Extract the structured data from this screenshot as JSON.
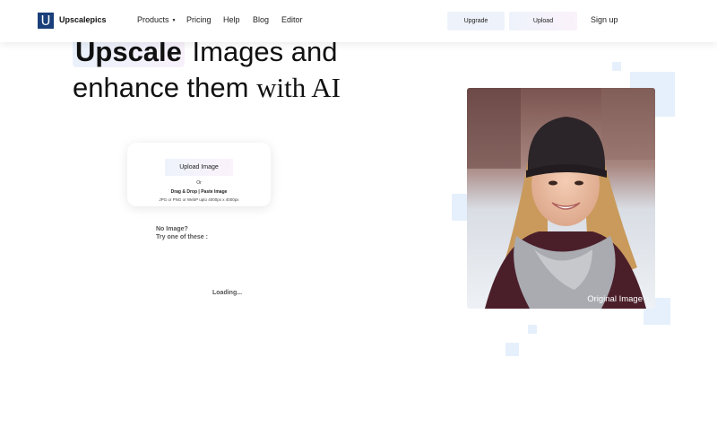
{
  "nav": {
    "logo_letter": "U",
    "brand": "Upscalepics",
    "links": [
      "Products",
      "Pricing",
      "Help",
      "Blog",
      "Editor"
    ],
    "caret": "▼",
    "upgrade_label": "Upgrade",
    "upload_label": "Upload",
    "signup_label": "Sign up"
  },
  "hero": {
    "highlight": "Upscale",
    "line1_rest": " Images and",
    "line2_a": "enhance them ",
    "line2_b": "with AI"
  },
  "upload_card": {
    "button_label": "Upload Image",
    "or_text": "Or",
    "drag_text": "Drag & Drop | Paste Image",
    "hint_text": "JPG or PNG or WebP upto 4000px x 4000px"
  },
  "samples": {
    "line1": "No Image?",
    "line2": "Try one of these :",
    "loading": "Loading..."
  },
  "preview": {
    "label": "Original Image"
  },
  "colors": {
    "logo_bg": "#1a3f7a",
    "decor": "#e6f0fc"
  }
}
